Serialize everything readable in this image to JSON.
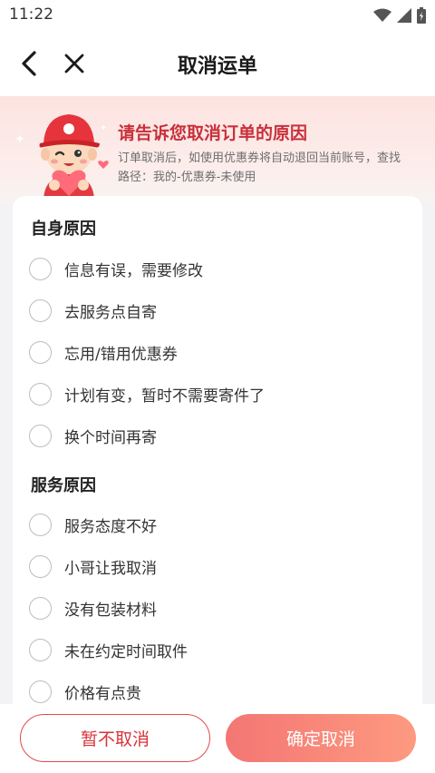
{
  "status_bar": {
    "time": "11:22",
    "icons": [
      "wifi-icon",
      "signal-icon",
      "battery-icon"
    ]
  },
  "nav": {
    "title": "取消运单"
  },
  "banner": {
    "title": "请告诉您取消订单的原因",
    "subtitle": "订单取消后，如使用优惠券将自动退回当前账号，查找路径：我的-优惠券-未使用"
  },
  "sections": [
    {
      "title": "自身原因",
      "options": [
        "信息有误，需要修改",
        "去服务点自寄",
        "忘用/错用优惠券",
        "计划有变，暂时不需要寄件了",
        "换个时间再寄"
      ]
    },
    {
      "title": "服务原因",
      "options": [
        "服务态度不好",
        "小哥让我取消",
        "没有包装材料",
        "未在约定时间取件",
        "价格有点贵"
      ]
    }
  ],
  "footer": {
    "keep_label": "暂不取消",
    "confirm_label": "确定取消"
  },
  "colors": {
    "accent": "#d8333b",
    "confirm_start": "#f47674",
    "confirm_end": "#fd9a80"
  }
}
